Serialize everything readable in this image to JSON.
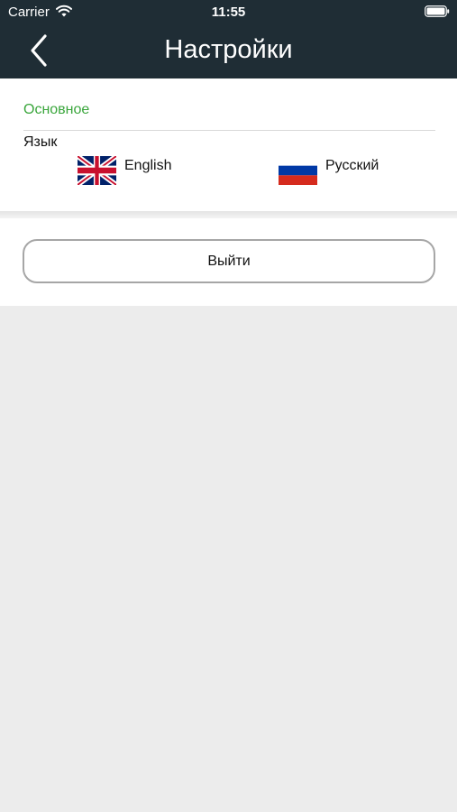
{
  "status_bar": {
    "carrier": "Carrier",
    "time": "11:55",
    "wifi_icon": "wifi-icon",
    "battery_icon": "battery-icon"
  },
  "nav": {
    "title": "Настройки",
    "back_icon": "chevron-left-icon"
  },
  "settings": {
    "section_title": "Основное",
    "language_label": "Язык",
    "languages": [
      {
        "label": "English",
        "flag_icon": "uk-flag-icon"
      },
      {
        "label": "Русский",
        "flag_icon": "russia-flag-icon"
      }
    ]
  },
  "actions": {
    "logout_label": "Выйти"
  },
  "colors": {
    "header_background": "#1f2d35",
    "section_title": "#3aa63c",
    "page_background": "#ececec",
    "button_border": "#a6a6a6"
  }
}
